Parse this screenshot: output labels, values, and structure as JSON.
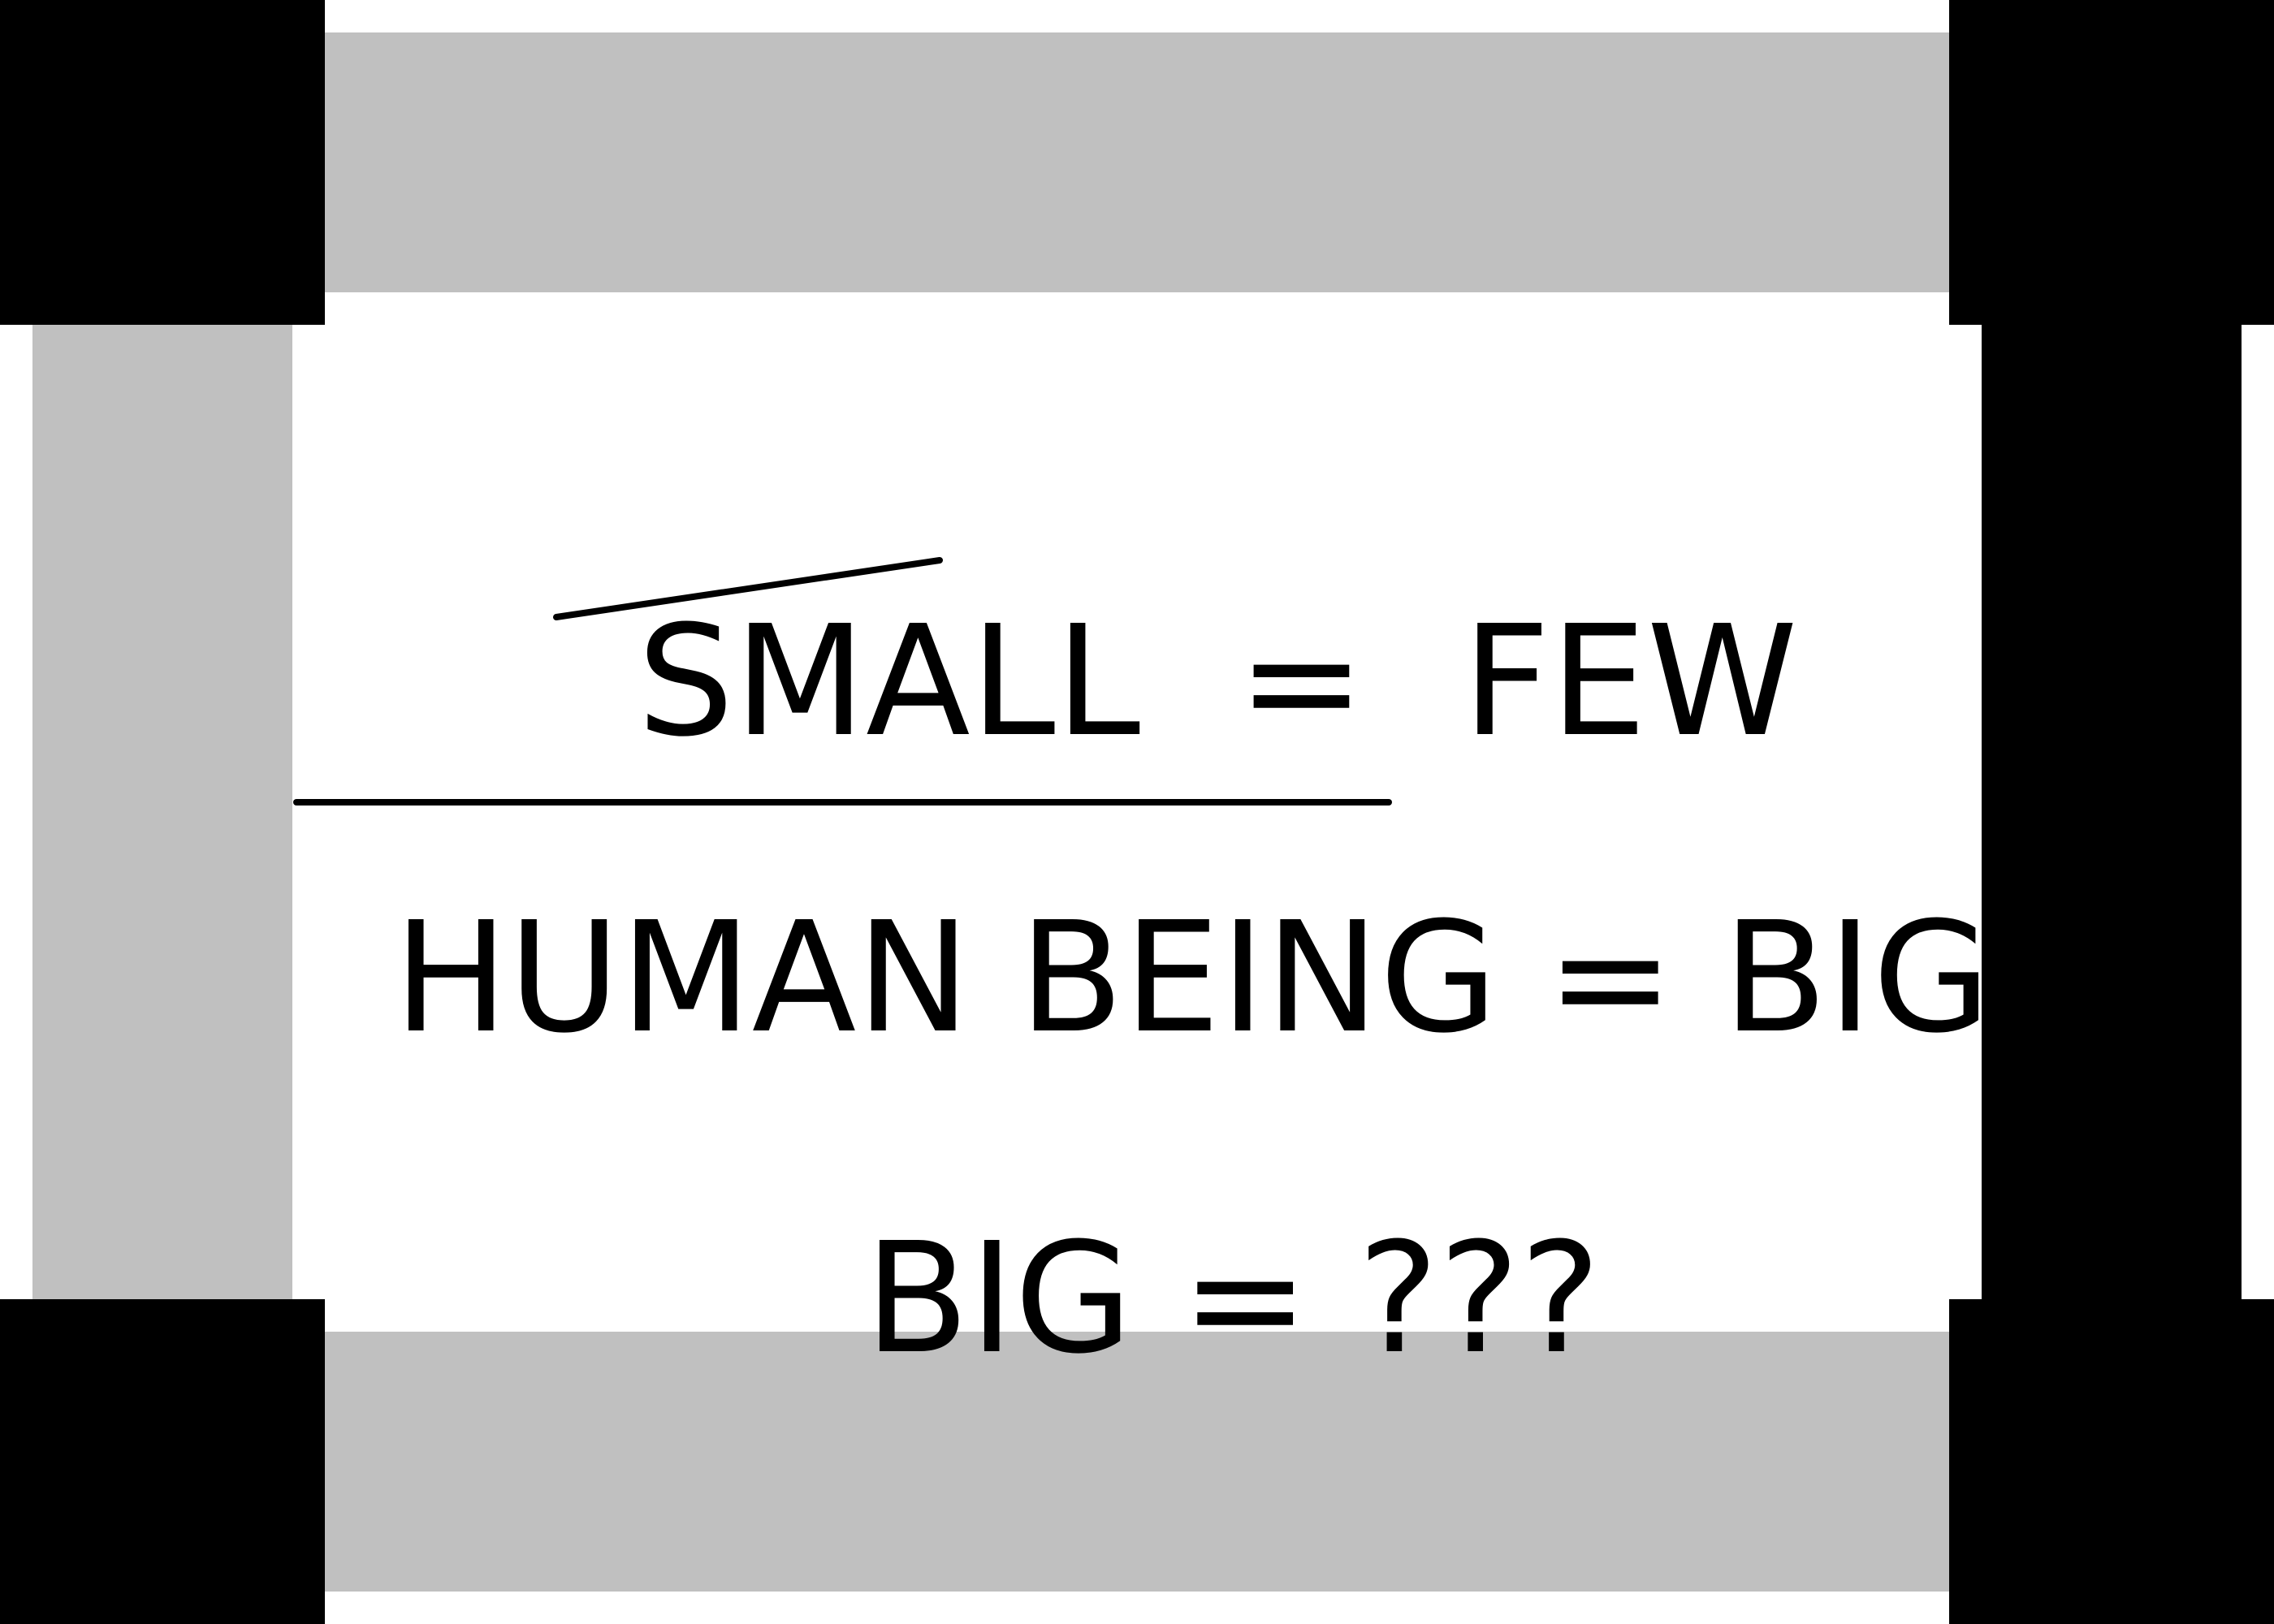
{
  "lines": {
    "line1": "SMALL  =  FEW",
    "line2_struck": "HUMAN BEING",
    "line2_rest": " = BIG",
    "line3": "BIG = ???"
  },
  "colors": {
    "background": "#ffffff",
    "frame_gray": "#c0c0c0",
    "frame_black": "#000000",
    "text": "#000000"
  }
}
